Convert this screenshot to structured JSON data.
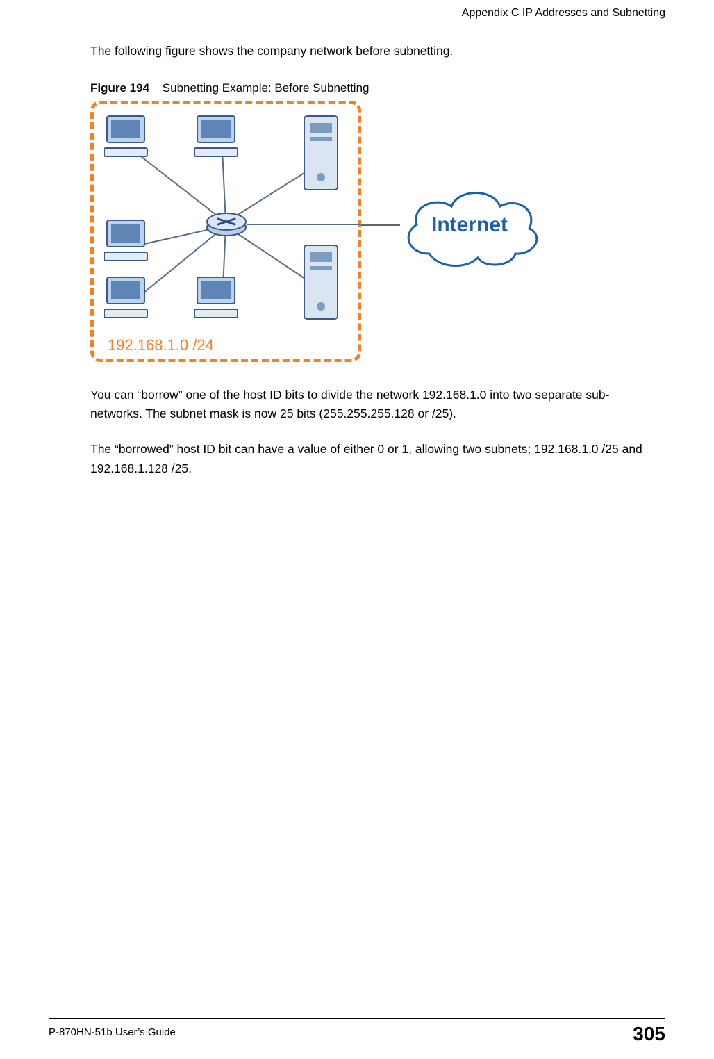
{
  "header": {
    "appendix_title": "Appendix C IP Addresses and Subnetting"
  },
  "body": {
    "intro": "The following figure shows the company network before subnetting.",
    "figure_label": "Figure 194",
    "figure_title": "Subnetting Example: Before Subnetting",
    "para2": "You can “borrow” one of the host ID bits to divide the network 192.168.1.0 into two separate sub-networks. The subnet mask is now 25 bits (255.255.255.128 or /25).",
    "para3": "The “borrowed” host ID bit can have a value of either 0 or 1, allowing two subnets; 192.168.1.0 /25 and 192.168.1.128 /25."
  },
  "diagram": {
    "network_label": "192.168.1.0 /24",
    "cloud_label": "Internet"
  },
  "footer": {
    "guide": "P-870HN-51b User’s Guide",
    "page_number": "305"
  }
}
